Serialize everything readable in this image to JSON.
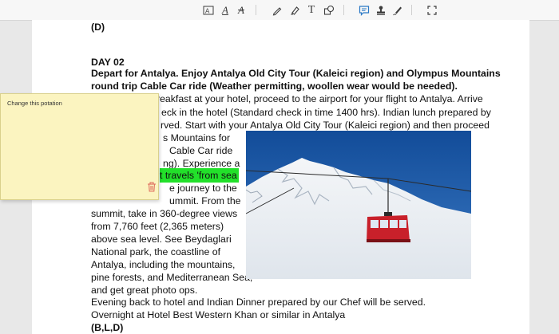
{
  "toolbar": {
    "icons": [
      "text-box-icon",
      "text-style-icon",
      "strikethrough-icon",
      "pen-icon",
      "highlighter-icon",
      "text-icon",
      "shapes-icon",
      "note-icon",
      "stamp-icon",
      "signature-icon",
      "crop-icon"
    ],
    "text_style_glyph": "A",
    "strike_glyph": "A",
    "text_glyph": "T"
  },
  "document": {
    "top_code": "(D)",
    "day_heading": "DAY 02",
    "bold_line_1": "Depart for Antalya. Enjoy Antalya Old City Tour (Kaleici region) and Olympus Mountains",
    "bold_line_2": "round trip Cable Car ride (Weather permitting, woollen wear would be needed).",
    "line_3": "reakfast at your hotel, proceed to the airport for your flight to Antalya. Arrive",
    "line_4": "eck in the hotel (Standard check in time 1400 hrs). Indian lunch prepared by",
    "line_5": "rved. Start with your Antalya Old City Tour (Kaleici region) and then proceed",
    "col_1": "s Mountains for",
    "col_2": "Cable Car ride",
    "col_3": "ng). Experience a",
    "col_4_highlight": "t travels 'from sea",
    "col_5": "e journey to the",
    "col_6": "ummit. From the",
    "col_7": "summit, take in 360-degree views",
    "col_8": "from 7,760 feet (2,365 meters)",
    "col_9": "above sea level. See Beydaglari",
    "col_10": "National park, the coastline of",
    "col_11": "Antalya, including the mountains,",
    "col_12": "pine forests, and Mediterranean Sea,",
    "col_13": "and get great photo ops.",
    "line_evening": "Evening back to hotel and Indian Dinner prepared by our Chef will be served.",
    "line_overnight": "Overnight at Hotel Best Western Khan or similar in Antalya",
    "bottom_code": "(B,L,D)"
  },
  "note": {
    "text": "Change this potation",
    "trash_icon": "trash-icon"
  },
  "photo": {
    "subject": "cable-car-over-snowy-mountain",
    "sky_color": "#1f5fae",
    "car_color": "#c8202a"
  },
  "colors": {
    "highlight": "#22e02a",
    "note_bg": "#fbf4c0",
    "accent": "#2a78c6"
  }
}
